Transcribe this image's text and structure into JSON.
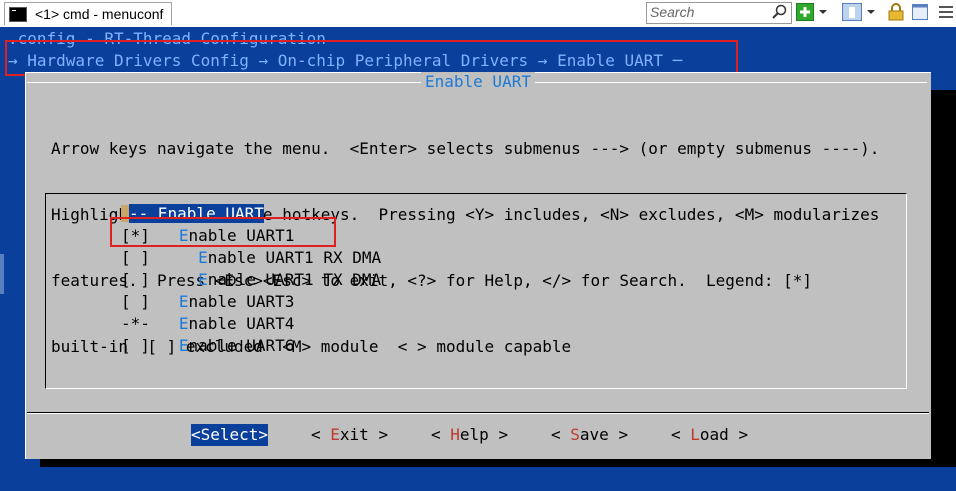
{
  "window": {
    "tab_label": "<1> cmd - menuconf",
    "search_placeholder": "Search"
  },
  "terminal": {
    "config_line": ".config - RT-Thread Configuration",
    "breadcrumb": "→ Hardware Drivers Config → On-chip Peripheral Drivers → Enable UART ─"
  },
  "dialog": {
    "title": "Enable UART",
    "help_lines": [
      "Arrow keys navigate the menu.  <Enter> selects submenus ---> (or empty submenus ----).",
      "Highlighted letters are hotkeys.  Pressing <Y> includes, <N> excludes, <M> modularizes",
      "features.  Press <Esc><Esc> to exit, <?> for Help, </> for Search.  Legend: [*]",
      "built-in  [ ] excluded  <M> module  < > module capable"
    ],
    "items": [
      {
        "mark": "--",
        "indent": " ",
        "hotkey": "",
        "rest": "Enable UART"
      },
      {
        "mark": "[*]",
        "indent": "   ",
        "hotkey": "E",
        "rest": "nable UART1"
      },
      {
        "mark": "[ ]",
        "indent": "     ",
        "hotkey": "E",
        "rest": "nable UART1 RX DMA"
      },
      {
        "mark": "[ ]",
        "indent": "     ",
        "hotkey": "E",
        "rest": "nable UART1 TX DMA"
      },
      {
        "mark": "[ ]",
        "indent": "   ",
        "hotkey": "E",
        "rest": "nable UART3"
      },
      {
        "mark": "-*-",
        "indent": "   ",
        "hotkey": "E",
        "rest": "nable UART4"
      },
      {
        "mark": "[ ]",
        "indent": "   ",
        "hotkey": "E",
        "rest": "nable UART6"
      }
    ],
    "buttons": {
      "select": "<Select>",
      "exit_l": "< ",
      "exit_hk": "E",
      "exit_r": "xit >",
      "help_l": "< ",
      "help_hk": "H",
      "help_r": "elp >",
      "save_l": "< ",
      "save_hk": "S",
      "save_r": "ave >",
      "load_l": "< ",
      "load_hk": "L",
      "load_r": "oad >"
    }
  },
  "colors": {
    "terminal_bg": "#0a3f9c",
    "dialog_bg": "#c0c0c0",
    "hotkey": "#1c7ad6",
    "annotation": "#e02020"
  }
}
